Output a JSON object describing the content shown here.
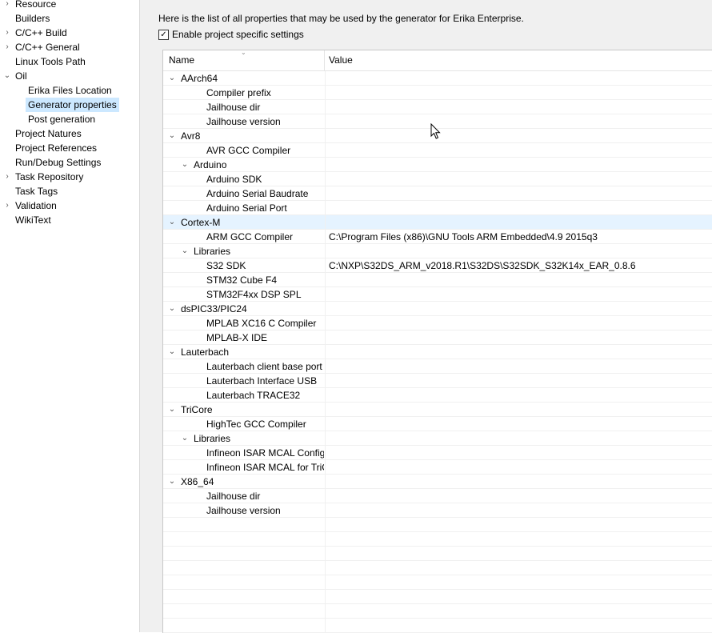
{
  "left_nav": {
    "items": [
      {
        "label": "Resource",
        "arrow": "›",
        "level": 0
      },
      {
        "label": "Builders",
        "arrow": "",
        "level": 0
      },
      {
        "label": "C/C++ Build",
        "arrow": "›",
        "level": 0
      },
      {
        "label": "C/C++ General",
        "arrow": "›",
        "level": 0
      },
      {
        "label": "Linux Tools Path",
        "arrow": "",
        "level": 0
      },
      {
        "label": "Oil",
        "arrow": "⌄",
        "level": 0
      },
      {
        "label": "Erika Files Location",
        "arrow": "",
        "level": 1
      },
      {
        "label": "Generator properties",
        "arrow": "",
        "level": 1,
        "selected": true
      },
      {
        "label": "Post generation",
        "arrow": "",
        "level": 1
      },
      {
        "label": "Project Natures",
        "arrow": "",
        "level": 0
      },
      {
        "label": "Project References",
        "arrow": "",
        "level": 0
      },
      {
        "label": "Run/Debug Settings",
        "arrow": "",
        "level": 0
      },
      {
        "label": "Task Repository",
        "arrow": "›",
        "level": 0
      },
      {
        "label": "Task Tags",
        "arrow": "",
        "level": 0
      },
      {
        "label": "Validation",
        "arrow": "›",
        "level": 0
      },
      {
        "label": "WikiText",
        "arrow": "",
        "level": 0
      }
    ]
  },
  "page": {
    "intro": "Here is the list of all properties that may be used by the generator for Erika Enterprise.",
    "enable_label": "Enable project specific settings",
    "enable_checked": "✓"
  },
  "table": {
    "col_name": "Name",
    "col_value": "Value",
    "rows": [
      {
        "name": "AArch64",
        "value": "",
        "level": 0,
        "expand": "⌄"
      },
      {
        "name": "Compiler prefix",
        "value": "",
        "level": 1,
        "expand": ""
      },
      {
        "name": "Jailhouse dir",
        "value": "",
        "level": 1,
        "expand": ""
      },
      {
        "name": "Jailhouse version",
        "value": "",
        "level": 1,
        "expand": ""
      },
      {
        "name": "Avr8",
        "value": "",
        "level": 0,
        "expand": "⌄"
      },
      {
        "name": "AVR GCC Compiler",
        "value": "",
        "level": 1,
        "expand": ""
      },
      {
        "name": "Arduino",
        "value": "",
        "level": 1,
        "expand": "⌄"
      },
      {
        "name": "Arduino SDK",
        "value": "",
        "level": 2,
        "expand": ""
      },
      {
        "name": "Arduino Serial Baudrate",
        "value": "",
        "level": 2,
        "expand": ""
      },
      {
        "name": "Arduino Serial Port",
        "value": "",
        "level": 2,
        "expand": ""
      },
      {
        "name": "Cortex-M",
        "value": "",
        "level": 0,
        "expand": "⌄",
        "hot": true
      },
      {
        "name": "ARM GCC Compiler",
        "value": "C:\\Program Files (x86)\\GNU Tools ARM Embedded\\4.9 2015q3",
        "level": 1,
        "expand": ""
      },
      {
        "name": "Libraries",
        "value": "",
        "level": 1,
        "expand": "⌄"
      },
      {
        "name": "S32 SDK",
        "value": "C:\\NXP\\S32DS_ARM_v2018.R1\\S32DS\\S32SDK_S32K14x_EAR_0.8.6",
        "level": 2,
        "expand": ""
      },
      {
        "name": "STM32 Cube F4",
        "value": "",
        "level": 2,
        "expand": ""
      },
      {
        "name": "STM32F4xx DSP SPL",
        "value": "",
        "level": 2,
        "expand": ""
      },
      {
        "name": "dsPIC33/PIC24",
        "value": "",
        "level": 0,
        "expand": "⌄"
      },
      {
        "name": "MPLAB XC16 C Compiler",
        "value": "",
        "level": 1,
        "expand": ""
      },
      {
        "name": "MPLAB-X IDE",
        "value": "",
        "level": 1,
        "expand": ""
      },
      {
        "name": "Lauterbach",
        "value": "",
        "level": 0,
        "expand": "⌄"
      },
      {
        "name": "Lauterbach client base port number",
        "value": "",
        "level": 1,
        "expand": ""
      },
      {
        "name": "Lauterbach Interface USB",
        "value": "",
        "level": 1,
        "expand": ""
      },
      {
        "name": "Lauterbach TRACE32",
        "value": "",
        "level": 1,
        "expand": ""
      },
      {
        "name": "TriCore",
        "value": "",
        "level": 0,
        "expand": "⌄"
      },
      {
        "name": "HighTec GCC Compiler",
        "value": "",
        "level": 1,
        "expand": ""
      },
      {
        "name": "Libraries",
        "value": "",
        "level": 1,
        "expand": "⌄"
      },
      {
        "name": "Infineon ISAR MCAL Configuration",
        "value": "",
        "level": 2,
        "expand": ""
      },
      {
        "name": "Infineon ISAR MCAL for TriCore",
        "value": "",
        "level": 2,
        "expand": ""
      },
      {
        "name": "X86_64",
        "value": "",
        "level": 0,
        "expand": "⌄"
      },
      {
        "name": "Jailhouse dir",
        "value": "",
        "level": 1,
        "expand": ""
      },
      {
        "name": "Jailhouse version",
        "value": "",
        "level": 1,
        "expand": ""
      }
    ],
    "empty_rows": 8
  },
  "colors": {
    "selection": "#cce8ff",
    "hover": "#e5f3ff",
    "pane_bg": "#f0f0f0"
  }
}
